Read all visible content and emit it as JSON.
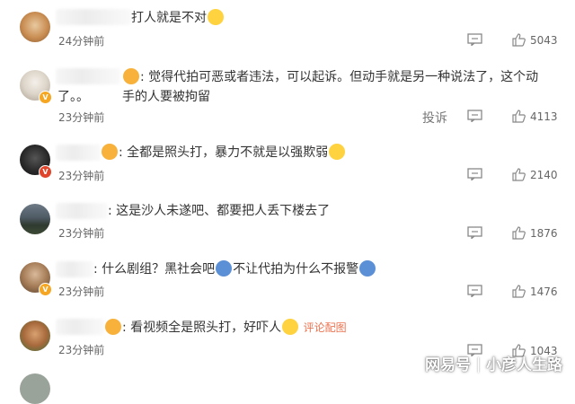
{
  "comments": [
    {
      "text": "打人就是不对",
      "time": "24分钟前",
      "likes": "5043",
      "name_label": ""
    },
    {
      "text_line1": ": 觉得代拍可恶或者违法，可以起诉。但动手就是另一种说法了，这个动手的人要被拘留",
      "text_line2": "了。。",
      "time": "23分钟前",
      "likes": "4113",
      "report_label": "投诉"
    },
    {
      "text": ": 全都是照头打，暴力不就是以强欺弱",
      "time": "23分钟前",
      "likes": "2140"
    },
    {
      "text": ": 这是沙人未遂吧、都要把人丢下楼去了",
      "time": "23分钟前",
      "likes": "1876"
    },
    {
      "text_a": ": 什么剧组？黑社会吧",
      "text_b": "不让代拍为什么不报警",
      "time": "23分钟前",
      "likes": "1476"
    },
    {
      "text": ": 看视频全是照头打，好吓人",
      "link": "评论配图",
      "time": "23分钟前",
      "likes": "1043"
    }
  ],
  "watermark": {
    "left": "网易号",
    "right": "小彦人生路"
  },
  "colors": {
    "link": "#eb7350",
    "badge_gold": "#f5a623",
    "badge_red": "#e0442a"
  },
  "icons": [
    "reply-icon",
    "like-icon",
    "emoji-icon",
    "verified-badge-icon"
  ]
}
